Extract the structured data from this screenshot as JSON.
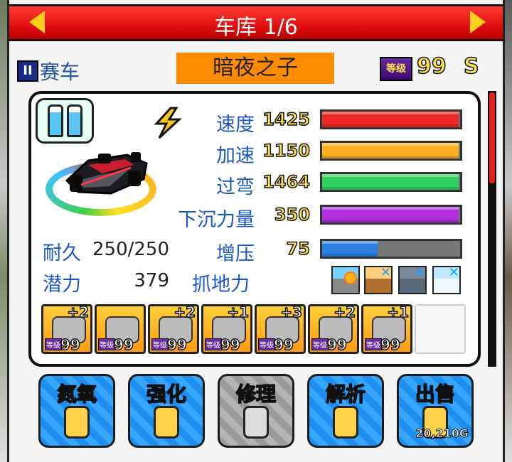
{
  "header": {
    "title": "车库 1/6"
  },
  "car": {
    "category": "赛车",
    "category_icon": "II",
    "name": "暗夜之子",
    "level_badge": "等级",
    "level": "99",
    "rank": "S"
  },
  "stats": [
    {
      "label": "速度",
      "value": "1425",
      "fill": 0.99,
      "color": "#f02828"
    },
    {
      "label": "加速",
      "value": "1150",
      "fill": 0.99,
      "color": "#ffb020"
    },
    {
      "label": "过弯",
      "value": "1464",
      "fill": 0.99,
      "color": "#30d060"
    },
    {
      "label": "下沉力量",
      "value": "350",
      "fill": 0.99,
      "color": "#b030e0"
    },
    {
      "label": "增压",
      "value": "75",
      "fill": 0.4,
      "color": "#2a80e0"
    }
  ],
  "durability": {
    "label": "耐久",
    "value": "250/250"
  },
  "potential": {
    "label": "潜力",
    "value": "379"
  },
  "grip": {
    "label": "抓地力"
  },
  "terrain": [
    "sunny-road-icon",
    "dirt-road-icon",
    "rain-road-icon",
    "snow-road-icon"
  ],
  "parts": [
    {
      "icon": "engine-icon",
      "plus": "+2",
      "level_badge": "等级",
      "level": "99"
    },
    {
      "icon": "tire-icon",
      "plus": "",
      "level_badge": "等级",
      "level": "99"
    },
    {
      "icon": "brake-icon",
      "plus": "+2",
      "level_badge": "等级",
      "level": "99"
    },
    {
      "icon": "turbo-icon",
      "plus": "+1",
      "level_badge": "等级",
      "level": "99"
    },
    {
      "icon": "wing-icon",
      "plus": "+3",
      "level_badge": "等级",
      "level": "99"
    },
    {
      "icon": "exhaust-icon",
      "plus": "+2",
      "level_badge": "等级",
      "level": "99"
    },
    {
      "icon": "chip-icon",
      "plus": "+1",
      "level_badge": "等级",
      "level": "99"
    }
  ],
  "buttons": [
    {
      "label": "氮氧",
      "icon": "nitro-bottle-icon"
    },
    {
      "label": "强化",
      "icon": "egg-icon"
    },
    {
      "label": "修理",
      "icon": "wrench-gear-icon",
      "disabled": true
    },
    {
      "label": "解析",
      "icon": "analysis-screen-icon"
    },
    {
      "label": "出售",
      "icon": "money-bag-icon",
      "price": "20,210G"
    }
  ]
}
